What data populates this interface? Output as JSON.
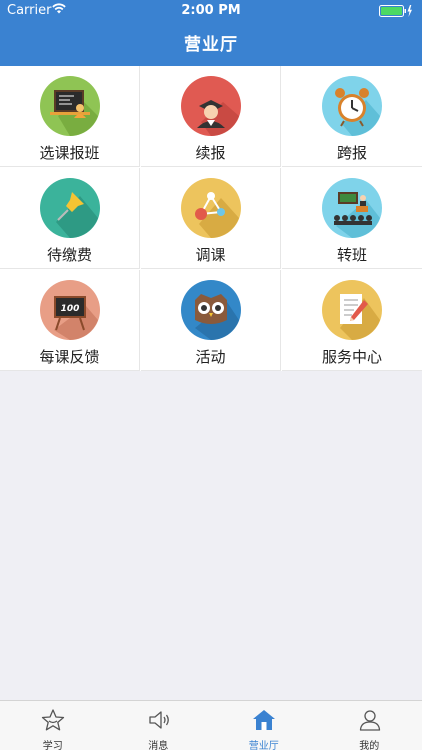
{
  "status_bar": {
    "carrier": "Carrier",
    "time": "2:00 PM"
  },
  "nav": {
    "title": "营业厅"
  },
  "grid": {
    "items": [
      {
        "label": "选课报班",
        "icon": "course-signup-icon"
      },
      {
        "label": "续报",
        "icon": "graduate-icon"
      },
      {
        "label": "跨报",
        "icon": "alarm-clock-icon"
      },
      {
        "label": "待缴费",
        "icon": "pushpin-icon"
      },
      {
        "label": "调课",
        "icon": "share-nodes-icon"
      },
      {
        "label": "转班",
        "icon": "classroom-icon"
      },
      {
        "label": "每课反馈",
        "icon": "score-board-icon"
      },
      {
        "label": "活动",
        "icon": "owl-icon"
      },
      {
        "label": "服务中心",
        "icon": "document-pencil-icon"
      }
    ]
  },
  "tabbar": {
    "tabs": [
      {
        "label": "学习",
        "icon": "star-icon",
        "active": false
      },
      {
        "label": "消息",
        "icon": "speaker-icon",
        "active": false
      },
      {
        "label": "营业厅",
        "icon": "home-icon",
        "active": true
      },
      {
        "label": "我的",
        "icon": "person-icon",
        "active": false
      }
    ]
  },
  "colors": {
    "primary": "#3a82d1",
    "background": "#efeff4"
  }
}
